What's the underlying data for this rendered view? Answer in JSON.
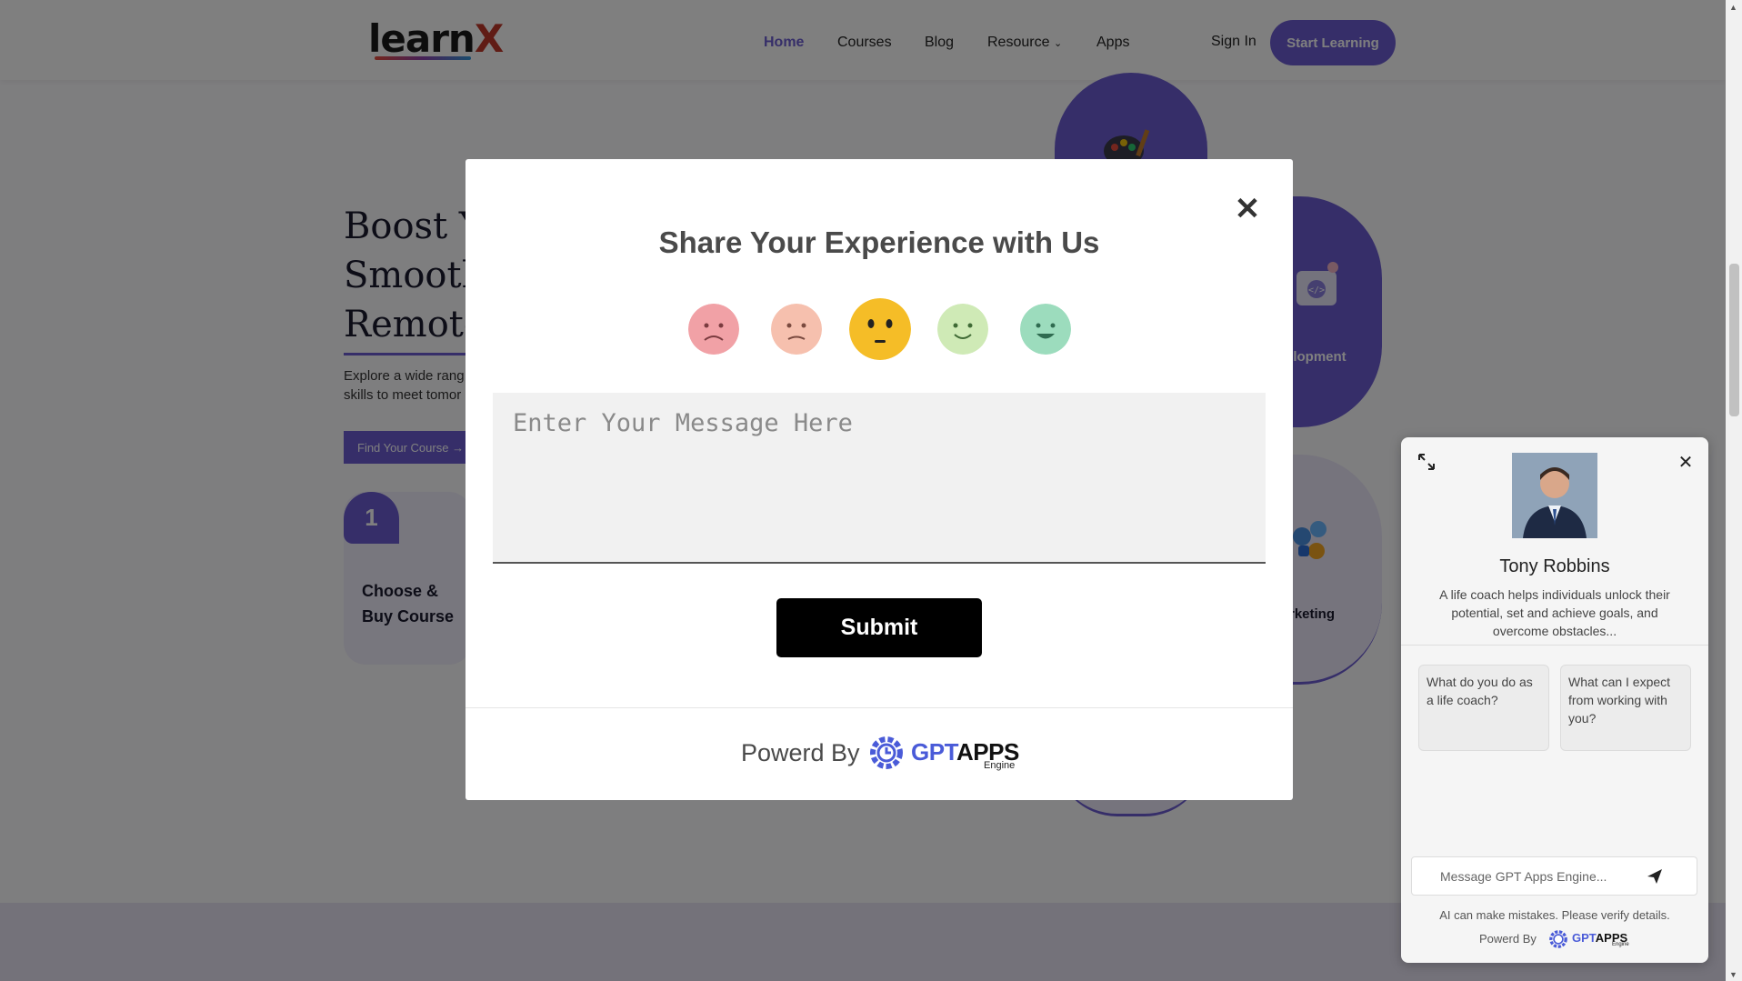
{
  "header": {
    "logo_text": "learn",
    "logo_accent": "X",
    "nav": [
      "Home",
      "Courses",
      "Blog",
      "Resource",
      "Apps"
    ],
    "sign_in": "Sign In",
    "start_learning": "Start Learning"
  },
  "hero": {
    "title_lines": [
      "Boost Yo",
      "Smooth",
      "Remote"
    ],
    "desc_lines": [
      "Explore a wide rang",
      "skills to meet tomor"
    ],
    "find_course": "Find Your Course →",
    "step_number": "1",
    "step_label": "Choose & Buy Course"
  },
  "categories": {
    "development": "elopment",
    "marketing": "rketing"
  },
  "modal": {
    "title": "Share Your Experience with Us",
    "message_placeholder": "Enter Your Message Here",
    "submit": "Submit",
    "powered_by": "Powerd By",
    "brand_gpt": "GPT",
    "brand_apps": "APPS",
    "brand_engine": "Engine",
    "selected_rating": 3,
    "rating_colors": [
      "#f1a1a6",
      "#f6c0ae",
      "#f5bd27",
      "#cfeab6",
      "#9cdcbd"
    ]
  },
  "chat": {
    "name": "Tony Robbins",
    "description": "A life coach helps individuals unlock their potential, set and achieve goals, and overcome obstacles...",
    "suggestions": [
      "What do you do as a life coach?",
      "What can I expect from working with you?"
    ],
    "input_placeholder": "Message GPT Apps Engine...",
    "disclaimer": "AI can make mistakes. Please verify details.",
    "powered_by": "Powerd By",
    "brand_gpt": "GPT",
    "brand_apps": "APPS",
    "brand_engine": "Engine"
  },
  "colors": {
    "accent": "#6c5dd3",
    "brand_blue": "#4a5bd8"
  }
}
